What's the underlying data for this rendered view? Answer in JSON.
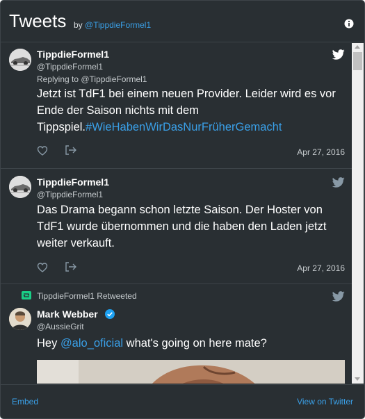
{
  "colors": {
    "background": "#292f33",
    "border": "#3d4449",
    "text": "#ffffff",
    "muted": "#c5cacd",
    "link": "#3aa0e8",
    "retweet": "#19cf86",
    "verified": "#1da1f2"
  },
  "header": {
    "title": "Tweets",
    "by_label": "by",
    "by_handle": "@TippdieFormel1",
    "info_icon": "info-icon"
  },
  "tweets": [
    {
      "name": "TippdieFormel1",
      "handle": "@TippdieFormel1",
      "reply_to": "Replying to @TippdieFormel1",
      "text": "Jetzt ist TdF1 bei einem neuen Provider. Leider wird es vor Ende der Saison nichts mit dem Tippspiel.",
      "hashtag": "#WieHabenWirDasNurFrüherGemacht",
      "date": "Apr 27, 2016",
      "icons": [
        "twitter-bird-icon",
        "heart-icon",
        "share-icon"
      ]
    },
    {
      "name": "TippdieFormel1",
      "handle": "@TippdieFormel1",
      "text": "Das Drama begann schon letzte Saison. Der Hoster von TdF1 wurde übernommen und die haben den Laden jetzt weiter verkauft.",
      "date": "Apr 27, 2016",
      "icons": [
        "twitter-bird-icon",
        "heart-icon",
        "share-icon"
      ]
    },
    {
      "retweeted_by": "TippdieFormel1 Retweeted",
      "name": "Mark Webber",
      "handle": "@AussieGrit",
      "text_before": "Hey ",
      "mention": "@alo_oficial",
      "text_after": " what's going on here mate?",
      "icons": [
        "retweet-icon",
        "verified-icon",
        "twitter-bird-icon"
      ]
    }
  ],
  "footer": {
    "embed": "Embed",
    "view_on_twitter": "View on Twitter"
  }
}
